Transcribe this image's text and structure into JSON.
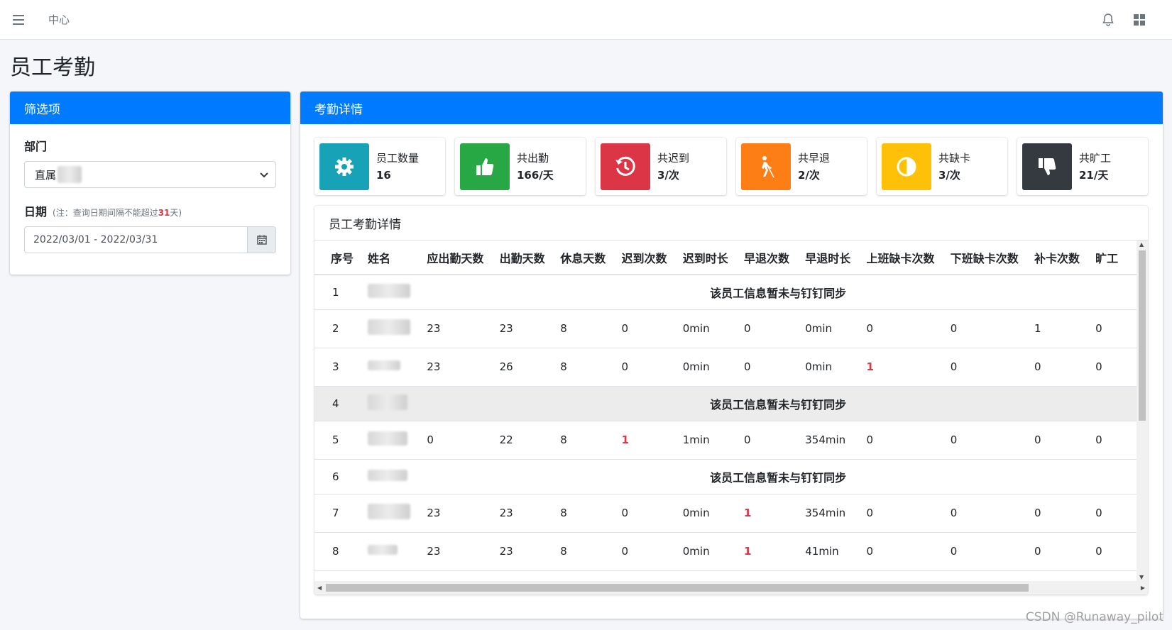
{
  "topbar": {
    "home": "中心"
  },
  "page_title": "员工考勤",
  "filter": {
    "header": "筛选项",
    "dept_label": "部门",
    "dept_value": "直属",
    "date_label": "日期",
    "date_note_prefix": "(注：查询日期间隔不能超过",
    "date_note_num": "31",
    "date_note_suffix": "天)",
    "date_value": "2022/03/01 - 2022/03/31"
  },
  "detail": {
    "header": "考勤详情",
    "stats": [
      {
        "label": "员工数量",
        "value": "16",
        "color": "#17a2b8",
        "icon": "gear-icon"
      },
      {
        "label": "共出勤",
        "value": "166/天",
        "color": "#28a745",
        "icon": "thumbs-up-icon"
      },
      {
        "label": "共迟到",
        "value": "3/次",
        "color": "#dc3545",
        "icon": "history-icon"
      },
      {
        "label": "共早退",
        "value": "2/次",
        "color": "#fd7e14",
        "icon": "walking-icon"
      },
      {
        "label": "共缺卡",
        "value": "3/次",
        "color": "#ffc107",
        "icon": "half-circle-icon"
      },
      {
        "label": "共旷工",
        "value": "21/天",
        "color": "#343a40",
        "icon": "thumbs-down-icon"
      }
    ],
    "table": {
      "title": "员工考勤详情",
      "headers": [
        "序号",
        "姓名",
        "应出勤天数",
        "出勤天数",
        "休息天数",
        "迟到次数",
        "迟到时长",
        "早退次数",
        "早退时长",
        "上班缺卡次数",
        "下班缺卡次数",
        "补卡次数",
        "旷工"
      ],
      "not_synced_msg": "该员工信息暂未与钉钉同步"
    }
  },
  "watermark": "CSDN @Runaway_pilot"
}
